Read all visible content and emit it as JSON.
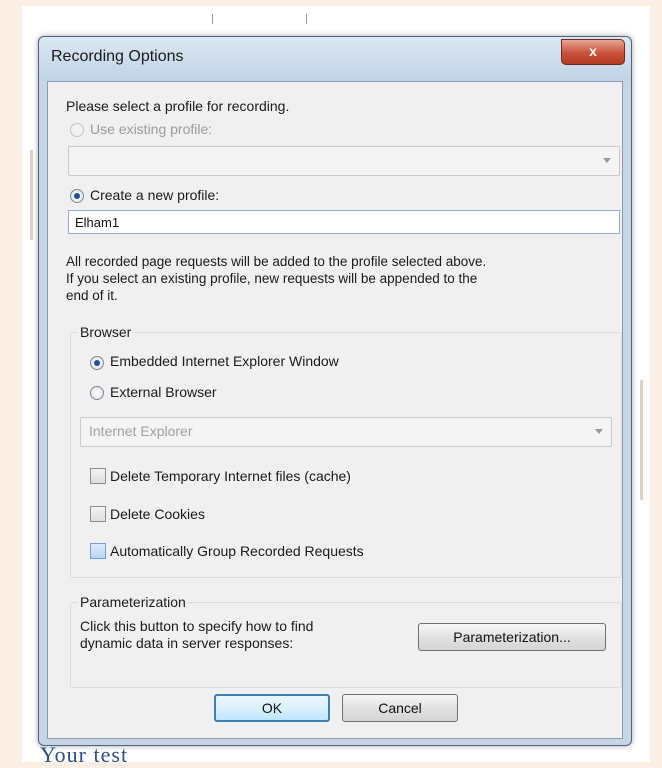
{
  "dialog": {
    "title": "Recording Options",
    "close_label": "x",
    "prompt": "Please select a profile for recording.",
    "use_existing_label": "Use existing profile:",
    "use_existing_selected": false,
    "existing_profile_value": "",
    "create_new_label": "Create a new profile:",
    "create_new_selected": true,
    "new_profile_name": "Elham1",
    "info_line1": "All recorded page requests will be added to the profile selected above.",
    "info_line2": "If you select an existing profile, new requests will be appended to the",
    "info_line3": "end of it."
  },
  "browser": {
    "group_label": "Browser",
    "embedded_label": "Embedded Internet Explorer Window",
    "embedded_selected": true,
    "external_label": "External Browser",
    "external_selected": false,
    "external_value": "Internet Explorer",
    "delete_temp_label": "Delete Temporary Internet files (cache)",
    "delete_temp_checked": false,
    "delete_cookies_label": "Delete Cookies",
    "delete_cookies_checked": false,
    "auto_group_label": "Automatically Group Recorded Requests",
    "auto_group_checked": false
  },
  "parameterization": {
    "group_label": "Parameterization",
    "desc_line1": "Click this button to specify how to find",
    "desc_line2": "dynamic data in server responses:",
    "button_label": "Parameterization..."
  },
  "footer": {
    "ok_label": "OK",
    "cancel_label": "Cancel"
  },
  "background": {
    "partial_text": "Your test"
  },
  "colors": {
    "accent": "#1f4f9a",
    "close": "#c75239",
    "page_bg": "#fbeee4"
  }
}
